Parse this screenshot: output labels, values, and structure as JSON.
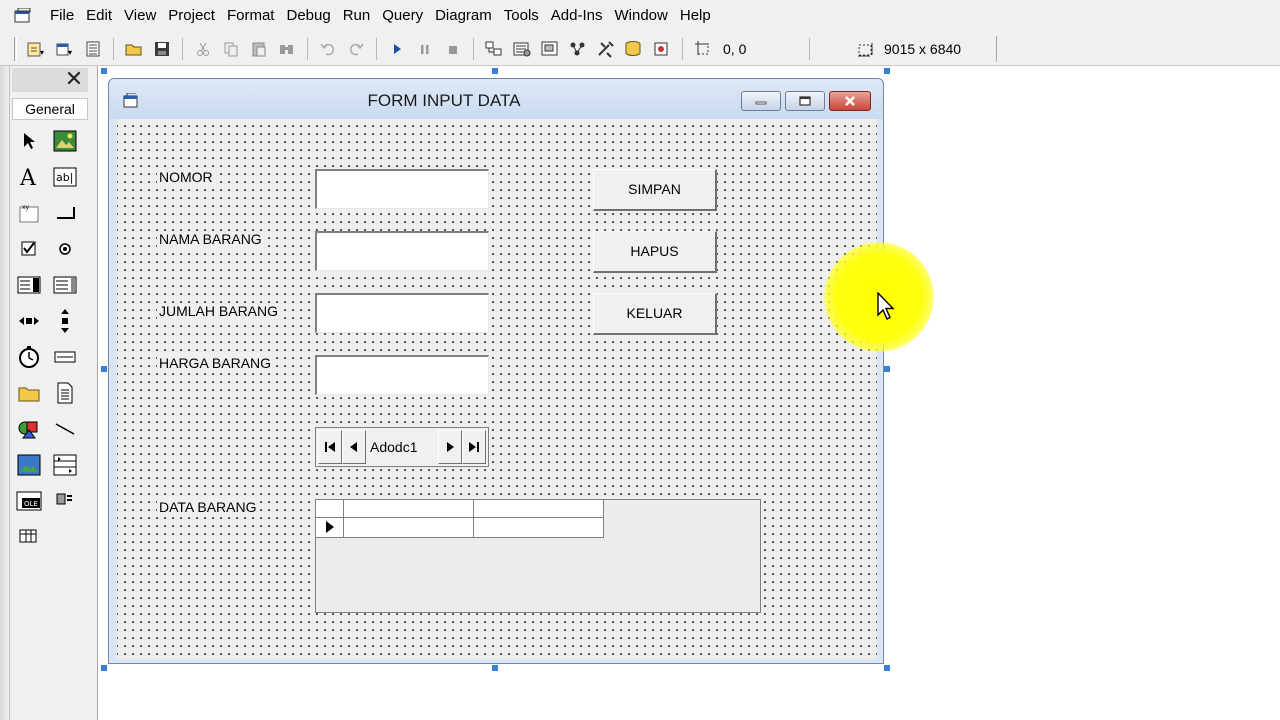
{
  "menubar": {
    "items": [
      {
        "label": "File"
      },
      {
        "label": "Edit"
      },
      {
        "label": "View"
      },
      {
        "label": "Project"
      },
      {
        "label": "Format"
      },
      {
        "label": "Debug"
      },
      {
        "label": "Run"
      },
      {
        "label": "Query"
      },
      {
        "label": "Diagram"
      },
      {
        "label": "Tools"
      },
      {
        "label": "Add-Ins"
      },
      {
        "label": "Window"
      },
      {
        "label": "Help"
      }
    ]
  },
  "toolbar": {
    "position_readout": "0, 0",
    "size_readout": "9015 x 6840"
  },
  "toolbox": {
    "tab_label": "General"
  },
  "form": {
    "title": "FORM INPUT DATA",
    "labels": {
      "nomor": "NOMOR",
      "nama_barang": "NAMA BARANG",
      "jumlah_barang": "JUMLAH BARANG",
      "harga_barang": "HARGA BARANG",
      "data_barang": "DATA BARANG"
    },
    "buttons": {
      "simpan": "SIMPAN",
      "hapus": "HAPUS",
      "keluar": "KELUAR"
    },
    "adodc_caption": "Adodc1"
  },
  "colors": {
    "form_border": "#6c8ab0",
    "close_button": "#c7463a",
    "cursor_highlight": "#ffff00",
    "selection_handle": "#3a7fd6"
  }
}
